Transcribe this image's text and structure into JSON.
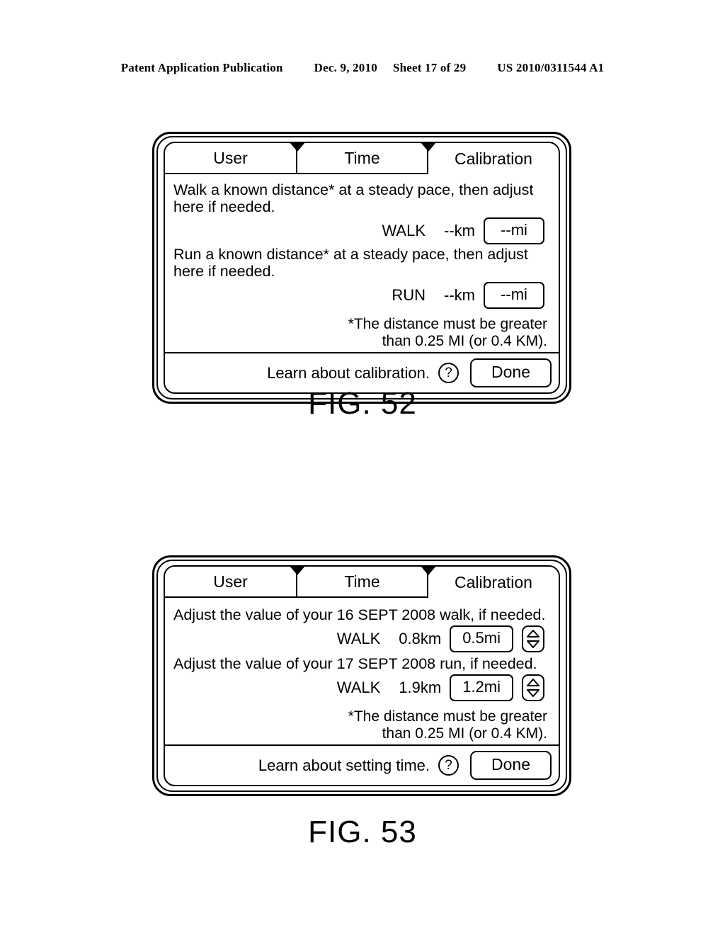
{
  "patent_header": {
    "publication": "Patent Application Publication",
    "date": "Dec. 9, 2010",
    "sheet": "Sheet 17 of 29",
    "number": "US 2010/0311544 A1"
  },
  "figures": [
    {
      "caption": "FIG. 52",
      "tabs": [
        {
          "label": "User",
          "selected": false
        },
        {
          "label": "Time",
          "selected": false
        },
        {
          "label": "Calibration",
          "selected": true
        }
      ],
      "rows": [
        {
          "instruction": "Walk a known distance* at a steady pace, then adjust here if needed.",
          "activity_label": "WALK",
          "km_value": "--km",
          "mi_value": "--mi",
          "has_stepper": false
        },
        {
          "instruction": "Run a known distance* at a steady pace, then adjust here if needed.",
          "activity_label": "RUN",
          "km_value": "--km",
          "mi_value": "--mi",
          "has_stepper": false
        }
      ],
      "footnote_line1": "*The distance must be greater",
      "footnote_line2": "than 0.25 MI (or 0.4 KM).",
      "footer": {
        "link_text": "Learn about calibration.",
        "help_icon": "question-mark-icon",
        "help_glyph": "?",
        "done_label": "Done"
      }
    },
    {
      "caption": "FIG. 53",
      "tabs": [
        {
          "label": "User",
          "selected": false
        },
        {
          "label": "Time",
          "selected": false
        },
        {
          "label": "Calibration",
          "selected": true
        }
      ],
      "rows": [
        {
          "instruction": "Adjust the value of your 16 SEPT 2008 walk, if needed.",
          "activity_label": "WALK",
          "km_value": "0.8km",
          "mi_value": "0.5mi",
          "has_stepper": true,
          "stepper_icon": "up-down-stepper-icon"
        },
        {
          "instruction": "Adjust the value of your 17 SEPT 2008 run, if needed.",
          "activity_label": "WALK",
          "km_value": "1.9km",
          "mi_value": "1.2mi",
          "has_stepper": true,
          "stepper_icon": "up-down-stepper-icon"
        }
      ],
      "footnote_line1": "*The distance must be greater",
      "footnote_line2": "than 0.25 MI (or 0.4 KM).",
      "footer": {
        "link_text": "Learn about setting time.",
        "help_icon": "question-mark-icon",
        "help_glyph": "?",
        "done_label": "Done"
      }
    }
  ],
  "colors": {
    "ink": "#000000",
    "paper": "#ffffff"
  }
}
